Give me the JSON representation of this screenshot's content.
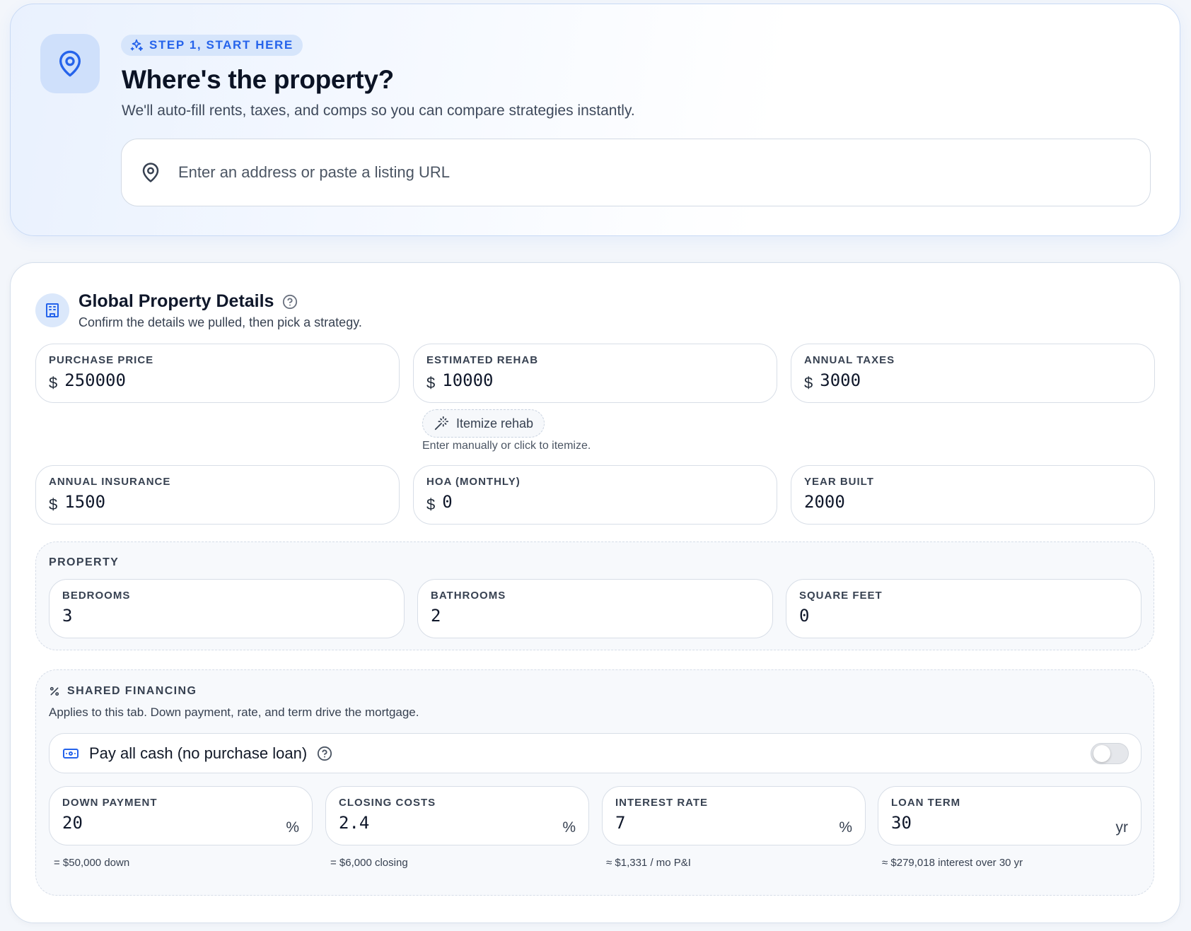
{
  "hero": {
    "step_label": "STEP 1, START HERE",
    "title": "Where's the property?",
    "subtitle": "We'll auto-fill rents, taxes, and comps so you can compare strategies instantly.",
    "address_placeholder": "Enter an address or paste a listing URL",
    "address_value": ""
  },
  "details": {
    "title": "Global Property Details",
    "subtitle": "Confirm the details we pulled, then pick a strategy.",
    "currency_symbol": "$",
    "fields": {
      "purchase_price": {
        "label": "PURCHASE PRICE",
        "value": "250000"
      },
      "estimated_rehab": {
        "label": "ESTIMATED REHAB",
        "value": "10000"
      },
      "annual_taxes": {
        "label": "ANNUAL TAXES",
        "value": "3000"
      },
      "annual_insurance": {
        "label": "ANNUAL INSURANCE",
        "value": "1500"
      },
      "hoa_monthly": {
        "label": "HOA (MONTHLY)",
        "value": "0"
      },
      "year_built": {
        "label": "YEAR BUILT",
        "value": "2000"
      }
    },
    "itemize_button": "Itemize rehab",
    "itemize_hint": "Enter manually or click to itemize."
  },
  "property": {
    "label": "PROPERTY",
    "bedrooms": {
      "label": "BEDROOMS",
      "value": "3"
    },
    "bathrooms": {
      "label": "BATHROOMS",
      "value": "2"
    },
    "square_feet": {
      "label": "SQUARE FEET",
      "value": "0"
    }
  },
  "financing": {
    "label": "SHARED FINANCING",
    "subtitle": "Applies to this tab. Down payment, rate, and term drive the mortgage.",
    "cash_toggle_label": "Pay all cash (no purchase loan)",
    "cash_toggle_on": false,
    "down_payment": {
      "label": "DOWN PAYMENT",
      "value": "20",
      "unit": "%",
      "hint": "= $50,000 down"
    },
    "closing_costs": {
      "label": "CLOSING COSTS",
      "value": "2.4",
      "unit": "%",
      "hint": "= $6,000 closing"
    },
    "interest_rate": {
      "label": "INTEREST RATE",
      "value": "7",
      "unit": "%",
      "hint": "≈ $1,331 / mo P&I"
    },
    "loan_term": {
      "label": "LOAN TERM",
      "value": "30",
      "unit": "yr",
      "hint": "≈ $279,018 interest over 30 yr"
    }
  },
  "colors": {
    "accent": "#2563eb",
    "accent_soft": "#d6e5fb",
    "border": "#d8dee7"
  }
}
